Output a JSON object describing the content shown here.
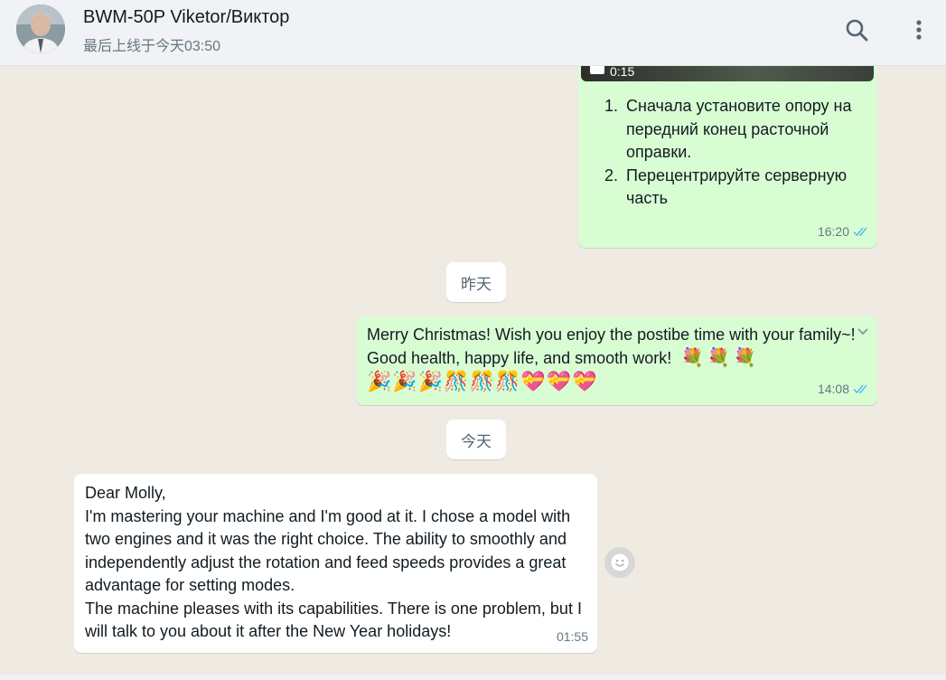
{
  "header": {
    "contact_name": "BWM-50P Viketor/Виктор",
    "last_seen": "最后上线于今天03:50",
    "icons": {
      "search": "search-icon",
      "menu": "menu-dots-icon"
    }
  },
  "messages": {
    "video_instructions": {
      "video_duration": "0:15",
      "item1_num": "1.",
      "item1_text": "Сначала установите опору на передний конец расточной оправки.",
      "item2_num": "2.",
      "item2_text": "Перецентрируйте серверную часть",
      "time": "16:20"
    },
    "date_yesterday": "昨天",
    "christmas": {
      "text": "Merry Christmas! Wish you enjoy the postibe time with your family~! Good health, happy life, and smooth work!",
      "emoji_bouquets": "💐💐💐",
      "emoji_row": "🎉🎉🎉🎊🎊🎊💝💝💝",
      "time": "14:08"
    },
    "date_today": "今天",
    "incoming": {
      "line1": "Dear Molly,",
      "line2": "I'm mastering your machine and I'm good at it. I chose a model with two engines and it was the right choice. The ability to smoothly and independently adjust the rotation and feed speeds provides a great advantage for setting modes.",
      "line3": "The machine pleases with its capabilities. There is one problem, but I will talk to you about it after the New Year holidays!",
      "time": "01:55"
    }
  },
  "colors": {
    "outgoing_bubble": "#d9fdd3",
    "incoming_bubble": "#ffffff",
    "chat_background": "#efeae2",
    "read_ticks": "#53bdeb"
  }
}
